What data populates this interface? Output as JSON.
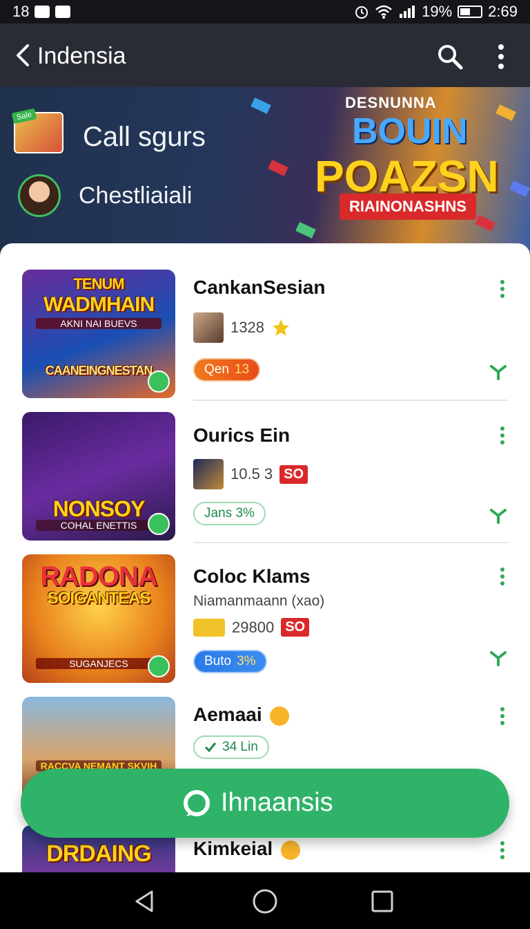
{
  "status": {
    "time_left": "18",
    "battery": "19%",
    "clock": "2:69"
  },
  "appbar": {
    "title": "Indensia"
  },
  "banner": {
    "tag": "Sale",
    "line1": "Call sgurs",
    "line2": "Chestliaiali",
    "promo_small": "DESNUNNA",
    "promo_line1": "BOUIN",
    "promo_line2": "POAZSN",
    "promo_ribbon": "RIAINONASHNS"
  },
  "items": [
    {
      "cover_title": "WADMHAIN",
      "cover_top": "TENUM",
      "cover_sub": "AKNI NAI BUEVS",
      "cover_bottom": "CAANEINGNESTAN",
      "title": "CankanSesian",
      "meta": "1328",
      "pill": "Qen",
      "pill_value": "13"
    },
    {
      "cover_title": "NONSOY",
      "cover_sub": "COHAL ENETTIS",
      "title": "Ourics Ein",
      "meta": "10.5 3",
      "badge": "SO",
      "pill": "Jans 3%"
    },
    {
      "cover_title": "RADONA",
      "cover_top": "SOIGANTEAS",
      "cover_sub": "SUGANJECS",
      "title": "Coloc Klams",
      "subtitle": "Niamanmaann (xao)",
      "meta": "29800",
      "badge": "SO",
      "pill": "Buto",
      "pill_value": "3%"
    },
    {
      "cover_sub": "RACCVA NEMANT SKVIH",
      "title": "Aemaai",
      "pill": "34 Lin"
    },
    {
      "cover_title": "DRDAING",
      "title": "Kimkeial"
    }
  ],
  "fab": {
    "label": "Ihnaansis"
  }
}
